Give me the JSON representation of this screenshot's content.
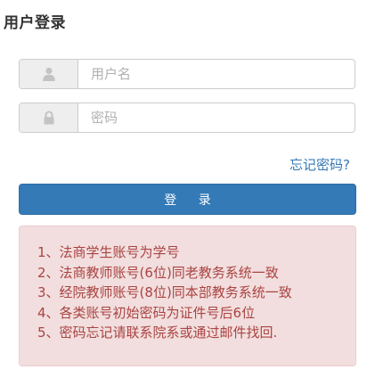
{
  "form": {
    "title": "用户登录",
    "username": {
      "placeholder": "用户名",
      "value": ""
    },
    "password": {
      "placeholder": "密码",
      "value": ""
    },
    "forgot_link": "忘记密码?",
    "login_button": "登 录"
  },
  "icons": {
    "username": "user-icon",
    "password": "lock-icon"
  },
  "notice": {
    "lines": [
      "1、法商学生账号为学号",
      "2、法商教师账号(6位)同老教务系统一致",
      "3、经院教师账号(8位)同本部教务系统一致",
      "4、各类账号初始密码为证件号后6位",
      "5、密码忘记请联系院系或通过邮件找回."
    ]
  },
  "colors": {
    "primary": "#337ab7",
    "alert_bg": "#f2dede",
    "alert_text": "#a94442"
  }
}
